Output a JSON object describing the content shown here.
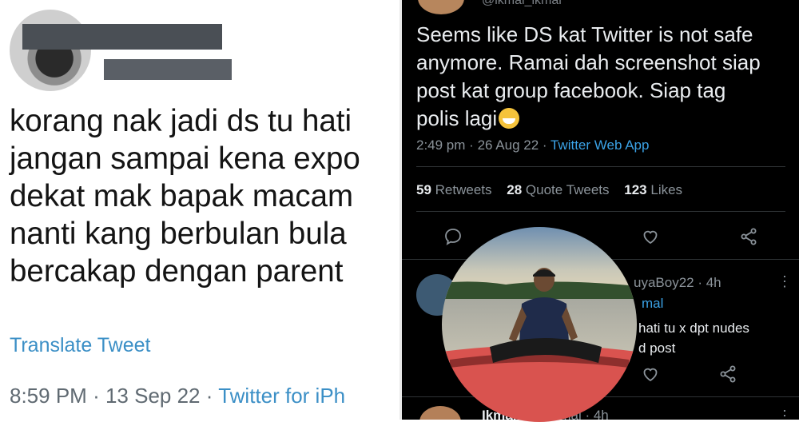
{
  "left_tweet": {
    "body_lines": [
      "korang nak jadi ds tu hati",
      "jangan sampai kena expo",
      "dekat mak bapak macam",
      "nanti kang berbulan bula",
      "bercakap dengan parent"
    ],
    "translate_label": "Translate Tweet",
    "time": "8:59 PM",
    "date": "13 Sep 22",
    "source": "Twitter for iPh",
    "separator": "·"
  },
  "right_tweet": {
    "handle_top": "@ikmal_ikmal",
    "body_lines": [
      "Seems like DS kat Twitter is not safe",
      "anymore. Ramai dah screenshot siap",
      "post kat group facebook. Siap tag",
      "polis lagi"
    ],
    "time": "2:49 pm",
    "date": "26 Aug 22",
    "source": "Twitter Web App",
    "separator": "·",
    "stats": [
      {
        "count": "59",
        "label": "Retweets"
      },
      {
        "count": "28",
        "label": "Quote Tweets"
      },
      {
        "count": "123",
        "label": "Likes"
      }
    ],
    "actions": [
      "reply-icon",
      "like-icon",
      "share-icon"
    ]
  },
  "reply": {
    "name": "uyaBoy22 · 4h",
    "sub": "mal",
    "text_lines": [
      "hati tu x dpt nudes",
      "d post"
    ],
    "menu": "⋮"
  },
  "reply2": {
    "name": "Ikmal",
    "handle": "mal_ikmal · 4h",
    "menu": "⋮"
  },
  "colors": {
    "twitter_blue": "#3ba2e6",
    "dark_bg": "#000000",
    "muted_text": "#8b939a"
  }
}
